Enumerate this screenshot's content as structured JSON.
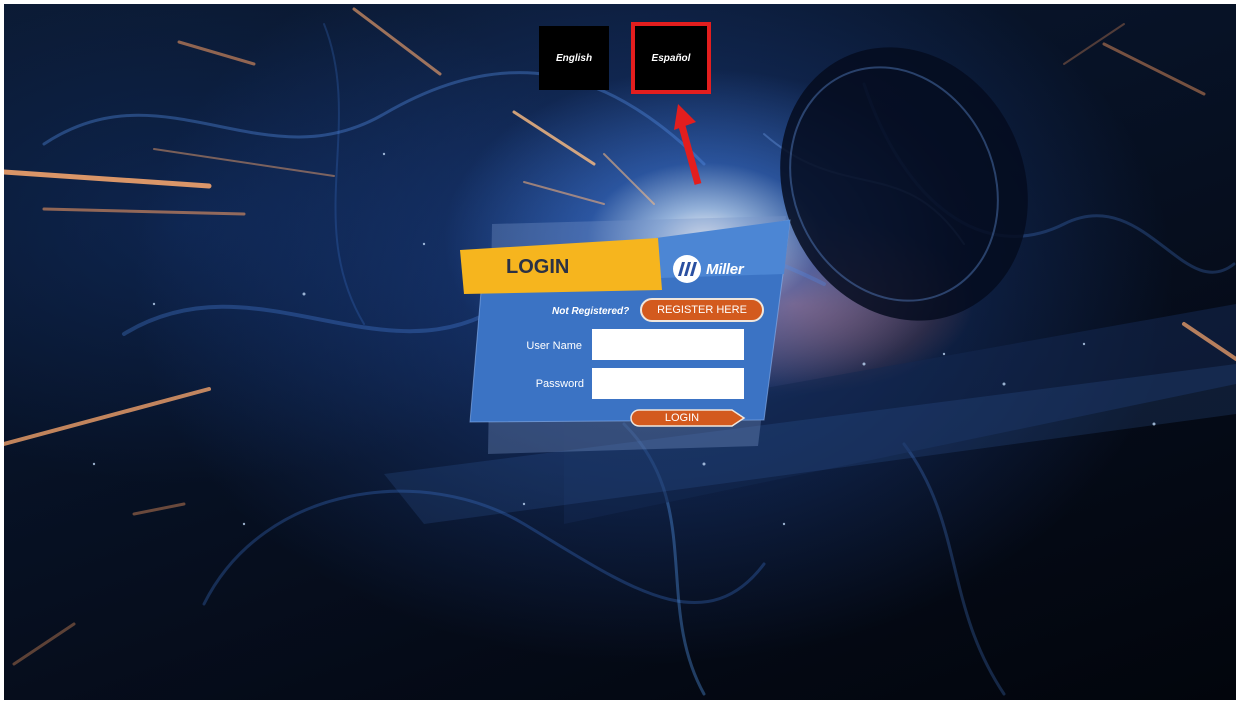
{
  "language_selector": {
    "english_label": "English",
    "spanish_label": "Español"
  },
  "login_panel": {
    "title": "LOGIN",
    "brand": "Miller",
    "not_registered_text": "Not Registered?",
    "register_label": "REGISTER HERE",
    "username_label": "User Name",
    "username_value": "",
    "password_label": "Password",
    "password_value": "",
    "login_label": "LOGIN"
  },
  "colors": {
    "title_banner": "#f6b51e",
    "panel_blue": "#3b73c4",
    "button_orange": "#d35a1e",
    "highlight_red": "#e31e1e"
  },
  "icons": [
    "miller-logo-icon",
    "red-arrow-annotation"
  ]
}
